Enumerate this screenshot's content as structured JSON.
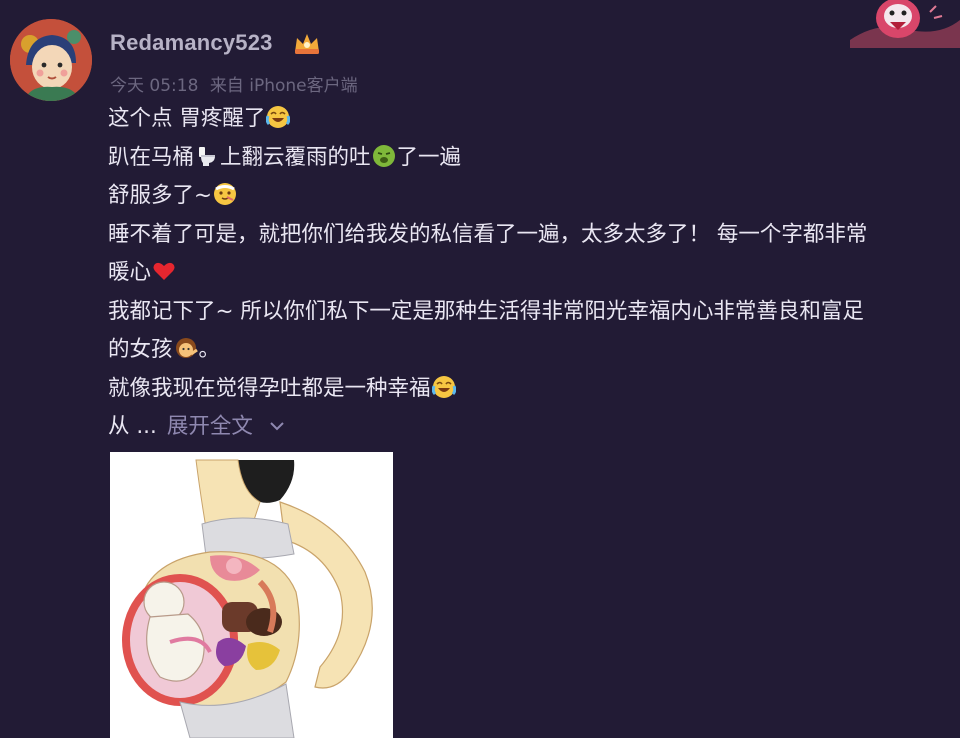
{
  "post": {
    "username": "Redamancy523",
    "timestamp": "今天 05:18",
    "source": "来自 iPhone客户端",
    "lines": [
      "这个点 胃疼醒了",
      "趴在马桶",
      "上翻云覆雨的吐",
      "了一遍",
      "舒服多了~",
      "睡不着了可是，就把你们给我发的私信看了一遍，太多太多了！ 每一个字都非常",
      "暖心",
      "我都记下了~ 所以你们私下一定是那种生活得非常阳光幸福内心非常善良和富足",
      "的女孩",
      "。",
      "就像我现在觉得孕吐都是一种幸福"
    ],
    "truncated_prefix": "从 ...",
    "expand_label": "展开全文"
  },
  "colors": {
    "background": "#221b35",
    "username": "#b7b2c6",
    "meta": "#6c6780",
    "link": "#8f88b0"
  },
  "icons": [
    "vip-crown-icon",
    "crying-laugh-emoji",
    "toilet-emoji",
    "nauseated-emoji",
    "dizzy-emoji",
    "red-heart-emoji",
    "girl-emoji",
    "chevron-down-icon"
  ]
}
